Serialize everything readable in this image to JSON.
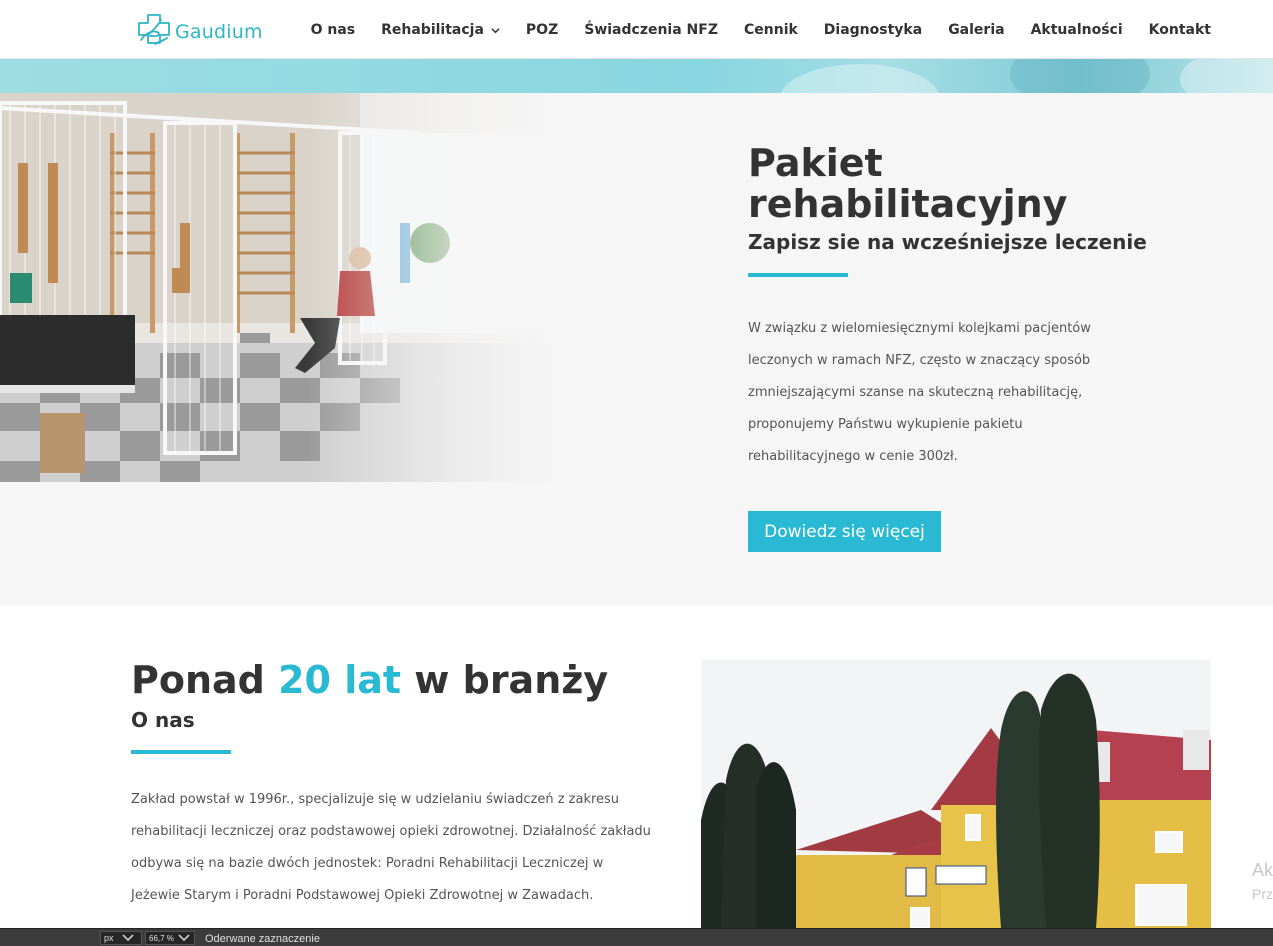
{
  "brand": {
    "name": "Gaudium",
    "color": "#2db6c5"
  },
  "nav": {
    "items": [
      {
        "label": "O nas"
      },
      {
        "label": "Rehabilitacja",
        "has_dropdown": true
      },
      {
        "label": "POZ"
      },
      {
        "label": "Świadczenia NFZ"
      },
      {
        "label": "Cennik"
      },
      {
        "label": "Diagnostyka"
      },
      {
        "label": "Galeria"
      },
      {
        "label": "Aktualności"
      },
      {
        "label": "Kontakt"
      }
    ]
  },
  "hero": {
    "title": "Pakiet rehabilitacyjny",
    "subtitle": "Zapisz sie na wcześniejsze leczenie",
    "body": "W związku z wielomiesięcznymi kolejkami pacjentów leczonych w ramach NFZ, często w znaczący sposób zmniejszającymi szanse na skuteczną rehabilitację, proponujemy Państwu wykupienie pakietu rehabilitacyjnego w cenie 300zł.",
    "button_label": "Dowiedz się więcej"
  },
  "about": {
    "title_before": "Ponad ",
    "title_highlight": "20 lat",
    "title_after": " w branży",
    "subtitle": "O nas",
    "body": "Zakład powstał w 1996r., specjalizuje się w udzielaniu świadczeń z zakresu rehabilitacji leczniczej oraz podstawowej opieki zdrowotnej. Działalność zakładu odbywa się na bazie dwóch jednostek: Poradni Rehabilitacji Leczniczej w Jeżewie Starym i Poradni Podstawowej Opieki Zdrowotnej w Zawadach."
  },
  "ghost_text": {
    "line1": "Ak",
    "line2": "Prz"
  },
  "statusbar": {
    "unit": "px",
    "zoom": "66,7 %",
    "selection_label": "Oderwane zaznaczenie"
  },
  "colors": {
    "accent": "#29b9d2",
    "hero_bg": "#f6f6f6",
    "statusbar_bg": "#3c3c3c"
  }
}
